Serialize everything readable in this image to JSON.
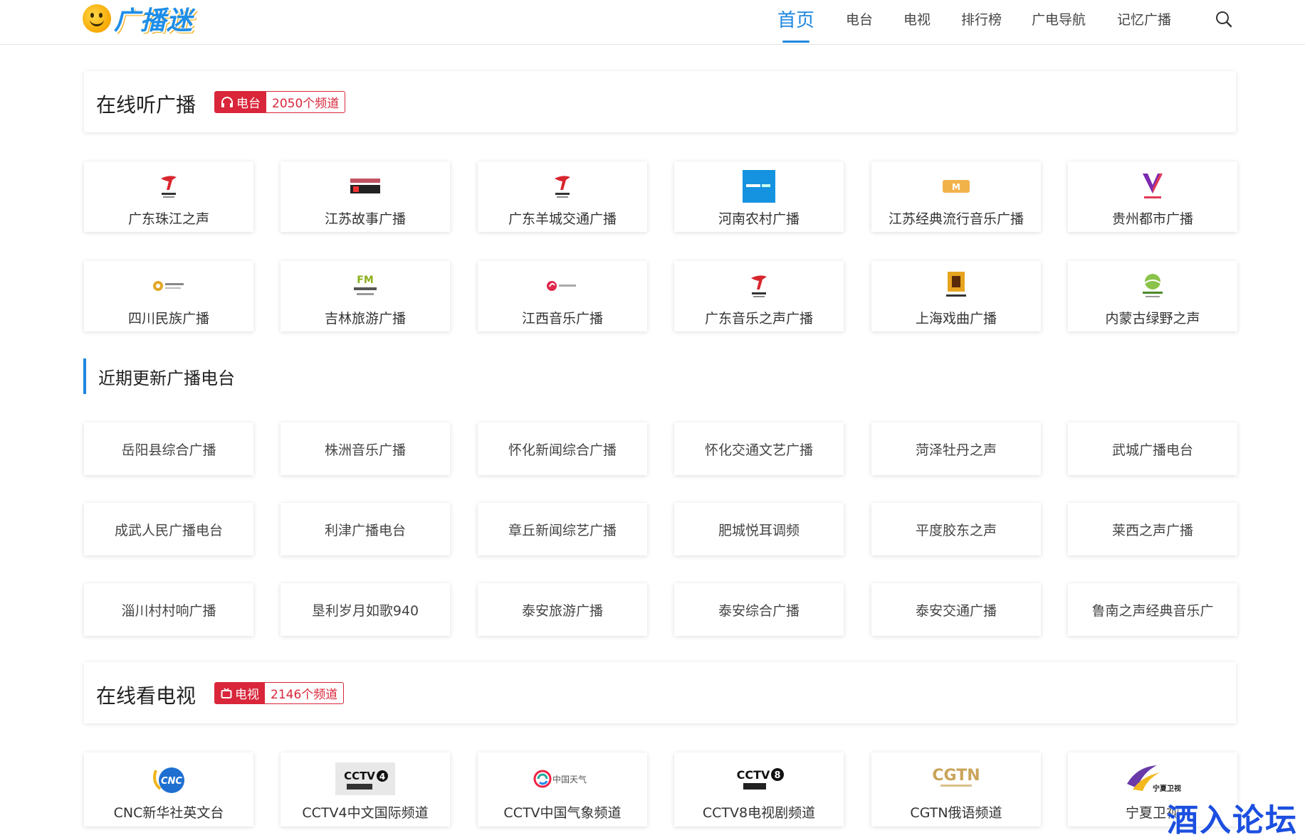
{
  "site": {
    "logo_text": "广播迷"
  },
  "nav": {
    "items": [
      {
        "label": "首页",
        "active": true
      },
      {
        "label": "电台"
      },
      {
        "label": "电视"
      },
      {
        "label": "排行榜"
      },
      {
        "label": "广电导航"
      },
      {
        "label": "记忆广播"
      }
    ],
    "search_icon": "search-icon"
  },
  "radio_section": {
    "title": "在线听广播",
    "badge_label": "电台",
    "badge_icon": "headphones-icon",
    "badge_count": "2050个频道",
    "featured": [
      {
        "name": "广东珠江之声",
        "logo": "red-swoosh"
      },
      {
        "name": "江苏故事广播",
        "logo": "text-mark"
      },
      {
        "name": "广东羊城交通广播",
        "logo": "red-swoosh"
      },
      {
        "name": "河南农村广播",
        "logo": "blue-square"
      },
      {
        "name": "江苏经典流行音乐广播",
        "logo": "music-mark"
      },
      {
        "name": "贵州都市广播",
        "logo": "v-mark"
      },
      {
        "name": "四川民族广播",
        "logo": "small-emblem"
      },
      {
        "name": "吉林旅游广播",
        "logo": "fm-mark"
      },
      {
        "name": "江西音乐广播",
        "logo": "small-red"
      },
      {
        "name": "广东音乐之声广播",
        "logo": "red-swoosh"
      },
      {
        "name": "上海戏曲广播",
        "logo": "opera-mark"
      },
      {
        "name": "内蒙古绿野之声",
        "logo": "green-mark"
      }
    ]
  },
  "recent_section": {
    "title": "近期更新广播电台",
    "items": [
      "岳阳县综合广播",
      "株洲音乐广播",
      "怀化新闻综合广播",
      "怀化交通文艺广播",
      "菏泽牡丹之声",
      "武城广播电台",
      "成武人民广播电台",
      "利津广播电台",
      "章丘新闻综艺广播",
      "肥城悦耳调频",
      "平度胶东之声",
      "莱西之声广播",
      "淄川村村响广播",
      "垦利岁月如歌940",
      "泰安旅游广播",
      "泰安综合广播",
      "泰安交通广播",
      "鲁南之声经典音乐广"
    ]
  },
  "tv_section": {
    "title": "在线看电视",
    "badge_label": "电视",
    "badge_icon": "tv-icon",
    "badge_count": "2146个频道",
    "featured": [
      {
        "name": "CNC新华社英文台",
        "logo": "cnc-mark",
        "logo_text": "CNC"
      },
      {
        "name": "CCTV4中文国际频道",
        "logo": "cctv4-mark",
        "logo_text": "CCTV4"
      },
      {
        "name": "CCTV中国气象频道",
        "logo": "weather-mark",
        "logo_text": "中国天气"
      },
      {
        "name": "CCTV8电视剧频道",
        "logo": "cctv8-mark",
        "logo_text": "CCTV8"
      },
      {
        "name": "CGTN俄语频道",
        "logo": "cgtn-mark",
        "logo_text": "CGTN"
      },
      {
        "name": "宁夏卫视",
        "logo": "ningxia-mark",
        "logo_text": "宁夏卫视"
      }
    ]
  },
  "watermark": "酒入论坛",
  "colors": {
    "accent": "#1e87e0",
    "badge_red": "#d9263a"
  }
}
